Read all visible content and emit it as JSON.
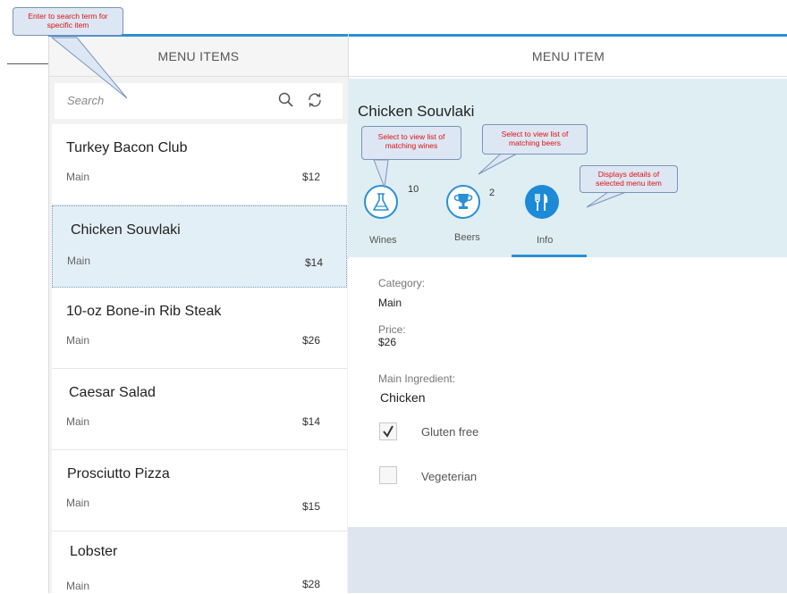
{
  "left_pane": {
    "header": "MENU ITEMS",
    "search": {
      "placeholder": "Search"
    },
    "items": [
      {
        "name": "Turkey Bacon Club",
        "category": "Main",
        "price": "$12"
      },
      {
        "name": "Chicken Souvlaki",
        "category": "Main",
        "price": "$14"
      },
      {
        "name": "10-oz Bone-in Rib Steak",
        "category": "Main",
        "price": "$26"
      },
      {
        "name": "Caesar Salad",
        "category": "Main",
        "price": "$14"
      },
      {
        "name": "Prosciutto Pizza",
        "category": "Main",
        "price": "$15"
      },
      {
        "name": "Lobster",
        "category": "Main",
        "price": "$28"
      }
    ],
    "selected_index": 1
  },
  "right_pane": {
    "header": "MENU ITEM",
    "title": "Chicken Souvlaki",
    "tabs": [
      {
        "label": "Wines",
        "count": "10",
        "icon": "flask-icon"
      },
      {
        "label": "Beers",
        "count": "2",
        "icon": "trophy-icon"
      },
      {
        "label": "Info",
        "count": "",
        "icon": "fork-knife-icon",
        "active": true
      }
    ],
    "details": {
      "category_label": "Category:",
      "category_value": "Main",
      "price_label": "Price:",
      "price_value": "$26",
      "ingredient_label": "Main Ingredient:",
      "ingredient_value": "Chicken",
      "gluten_free_label": "Gluten free",
      "gluten_free_checked": true,
      "vegetarian_label": "Vegeterian",
      "vegetarian_checked": false
    }
  },
  "callouts": {
    "search": "Enter to search term for specific item",
    "wines": "Select to view list of matching wines",
    "beers": "Select to view list of matching beers",
    "info": "Displays details of selected menu item"
  },
  "colors": {
    "accent": "#2b8fd6",
    "selected_bg": "#e3eff7",
    "header_bg": "#dfeef3",
    "callout_text": "#dd1111"
  }
}
